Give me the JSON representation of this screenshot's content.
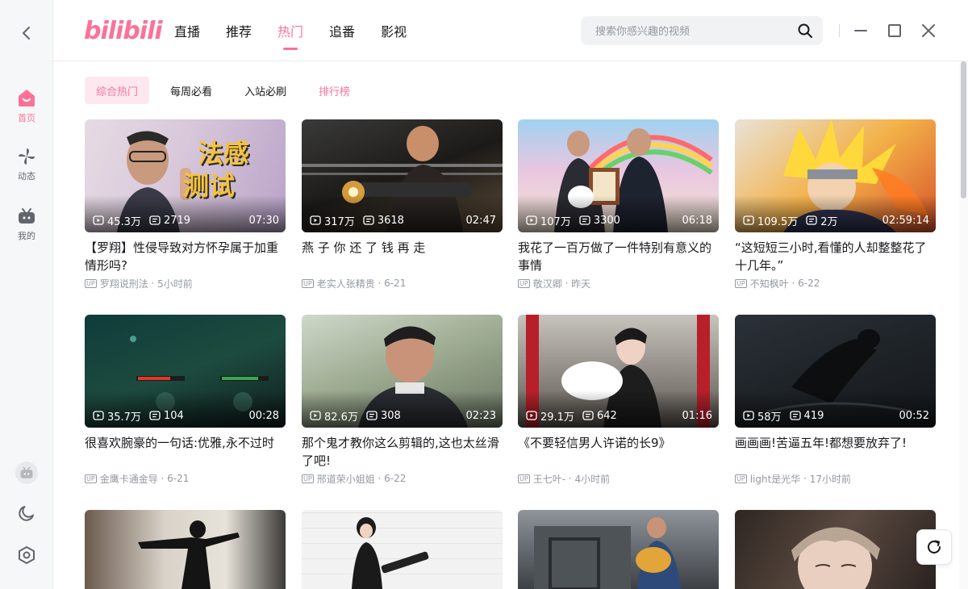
{
  "app": {
    "logo_text": "bilibili"
  },
  "rail": {
    "items": [
      {
        "label": "首页",
        "icon": "home-icon"
      },
      {
        "label": "动态",
        "icon": "pinwheel-icon"
      },
      {
        "label": "我的",
        "icon": "tv-icon"
      }
    ]
  },
  "nav": {
    "items": [
      "直播",
      "推荐",
      "热门",
      "追番",
      "影视"
    ],
    "active": "热门"
  },
  "search": {
    "placeholder": "搜索你感兴趣的视频",
    "value": ""
  },
  "subtabs": {
    "items": [
      "综合热门",
      "每周必看",
      "入站必刷",
      "排行榜"
    ],
    "active": "综合热门"
  },
  "colors": {
    "accent": "#fb7299",
    "accent_bg": "#fde8ef",
    "text_primary": "#18191c",
    "text_secondary": "#9499a0"
  },
  "videos": [
    {
      "views": "45.3万",
      "danmaku": "2719",
      "duration": "07:30",
      "title": "【罗翔】性侵导致对方怀孕属于加重情形吗?",
      "up": "罗翔说刑法",
      "time": "5小时前",
      "thumb_text": "法感测试"
    },
    {
      "views": "317万",
      "danmaku": "3618",
      "duration": "02:47",
      "title": "燕 子 你 还 了 钱 再 走",
      "up": "老实人张精贵",
      "time": "6-21",
      "thumb_text": ""
    },
    {
      "views": "107万",
      "danmaku": "3300",
      "duration": "06:18",
      "title": "我花了一百万做了一件特别有意义的事情",
      "up": "敬汉卿",
      "time": "昨天",
      "thumb_text": ""
    },
    {
      "views": "109.5万",
      "danmaku": "2万",
      "duration": "02:59:14",
      "title": "“这短短三小时,看懂的人却整整花了十几年。”",
      "up": "不知枫叶",
      "time": "6-22",
      "thumb_text": ""
    },
    {
      "views": "35.7万",
      "danmaku": "104",
      "duration": "00:28",
      "title": "很喜欢腕豪的一句话:优雅,永不过时",
      "up": "金鹰卡通金导",
      "time": "6-21",
      "thumb_text": ""
    },
    {
      "views": "82.6万",
      "danmaku": "308",
      "duration": "02:23",
      "title": "那个鬼才教你这么剪辑的,这也太丝滑了吧!",
      "up": "邢道荣小姐姐",
      "time": "6-22",
      "thumb_text": ""
    },
    {
      "views": "29.1万",
      "danmaku": "642",
      "duration": "01:16",
      "title": "《不要轻信男人许诺的长9》",
      "up": "王七叶-",
      "time": "4小时前",
      "thumb_text": ""
    },
    {
      "views": "58万",
      "danmaku": "419",
      "duration": "00:52",
      "title": "画画画!苦逼五年!都想要放弃了!",
      "up": "light是光华",
      "time": "17小时前",
      "thumb_text": ""
    }
  ],
  "badge_up": "UP"
}
